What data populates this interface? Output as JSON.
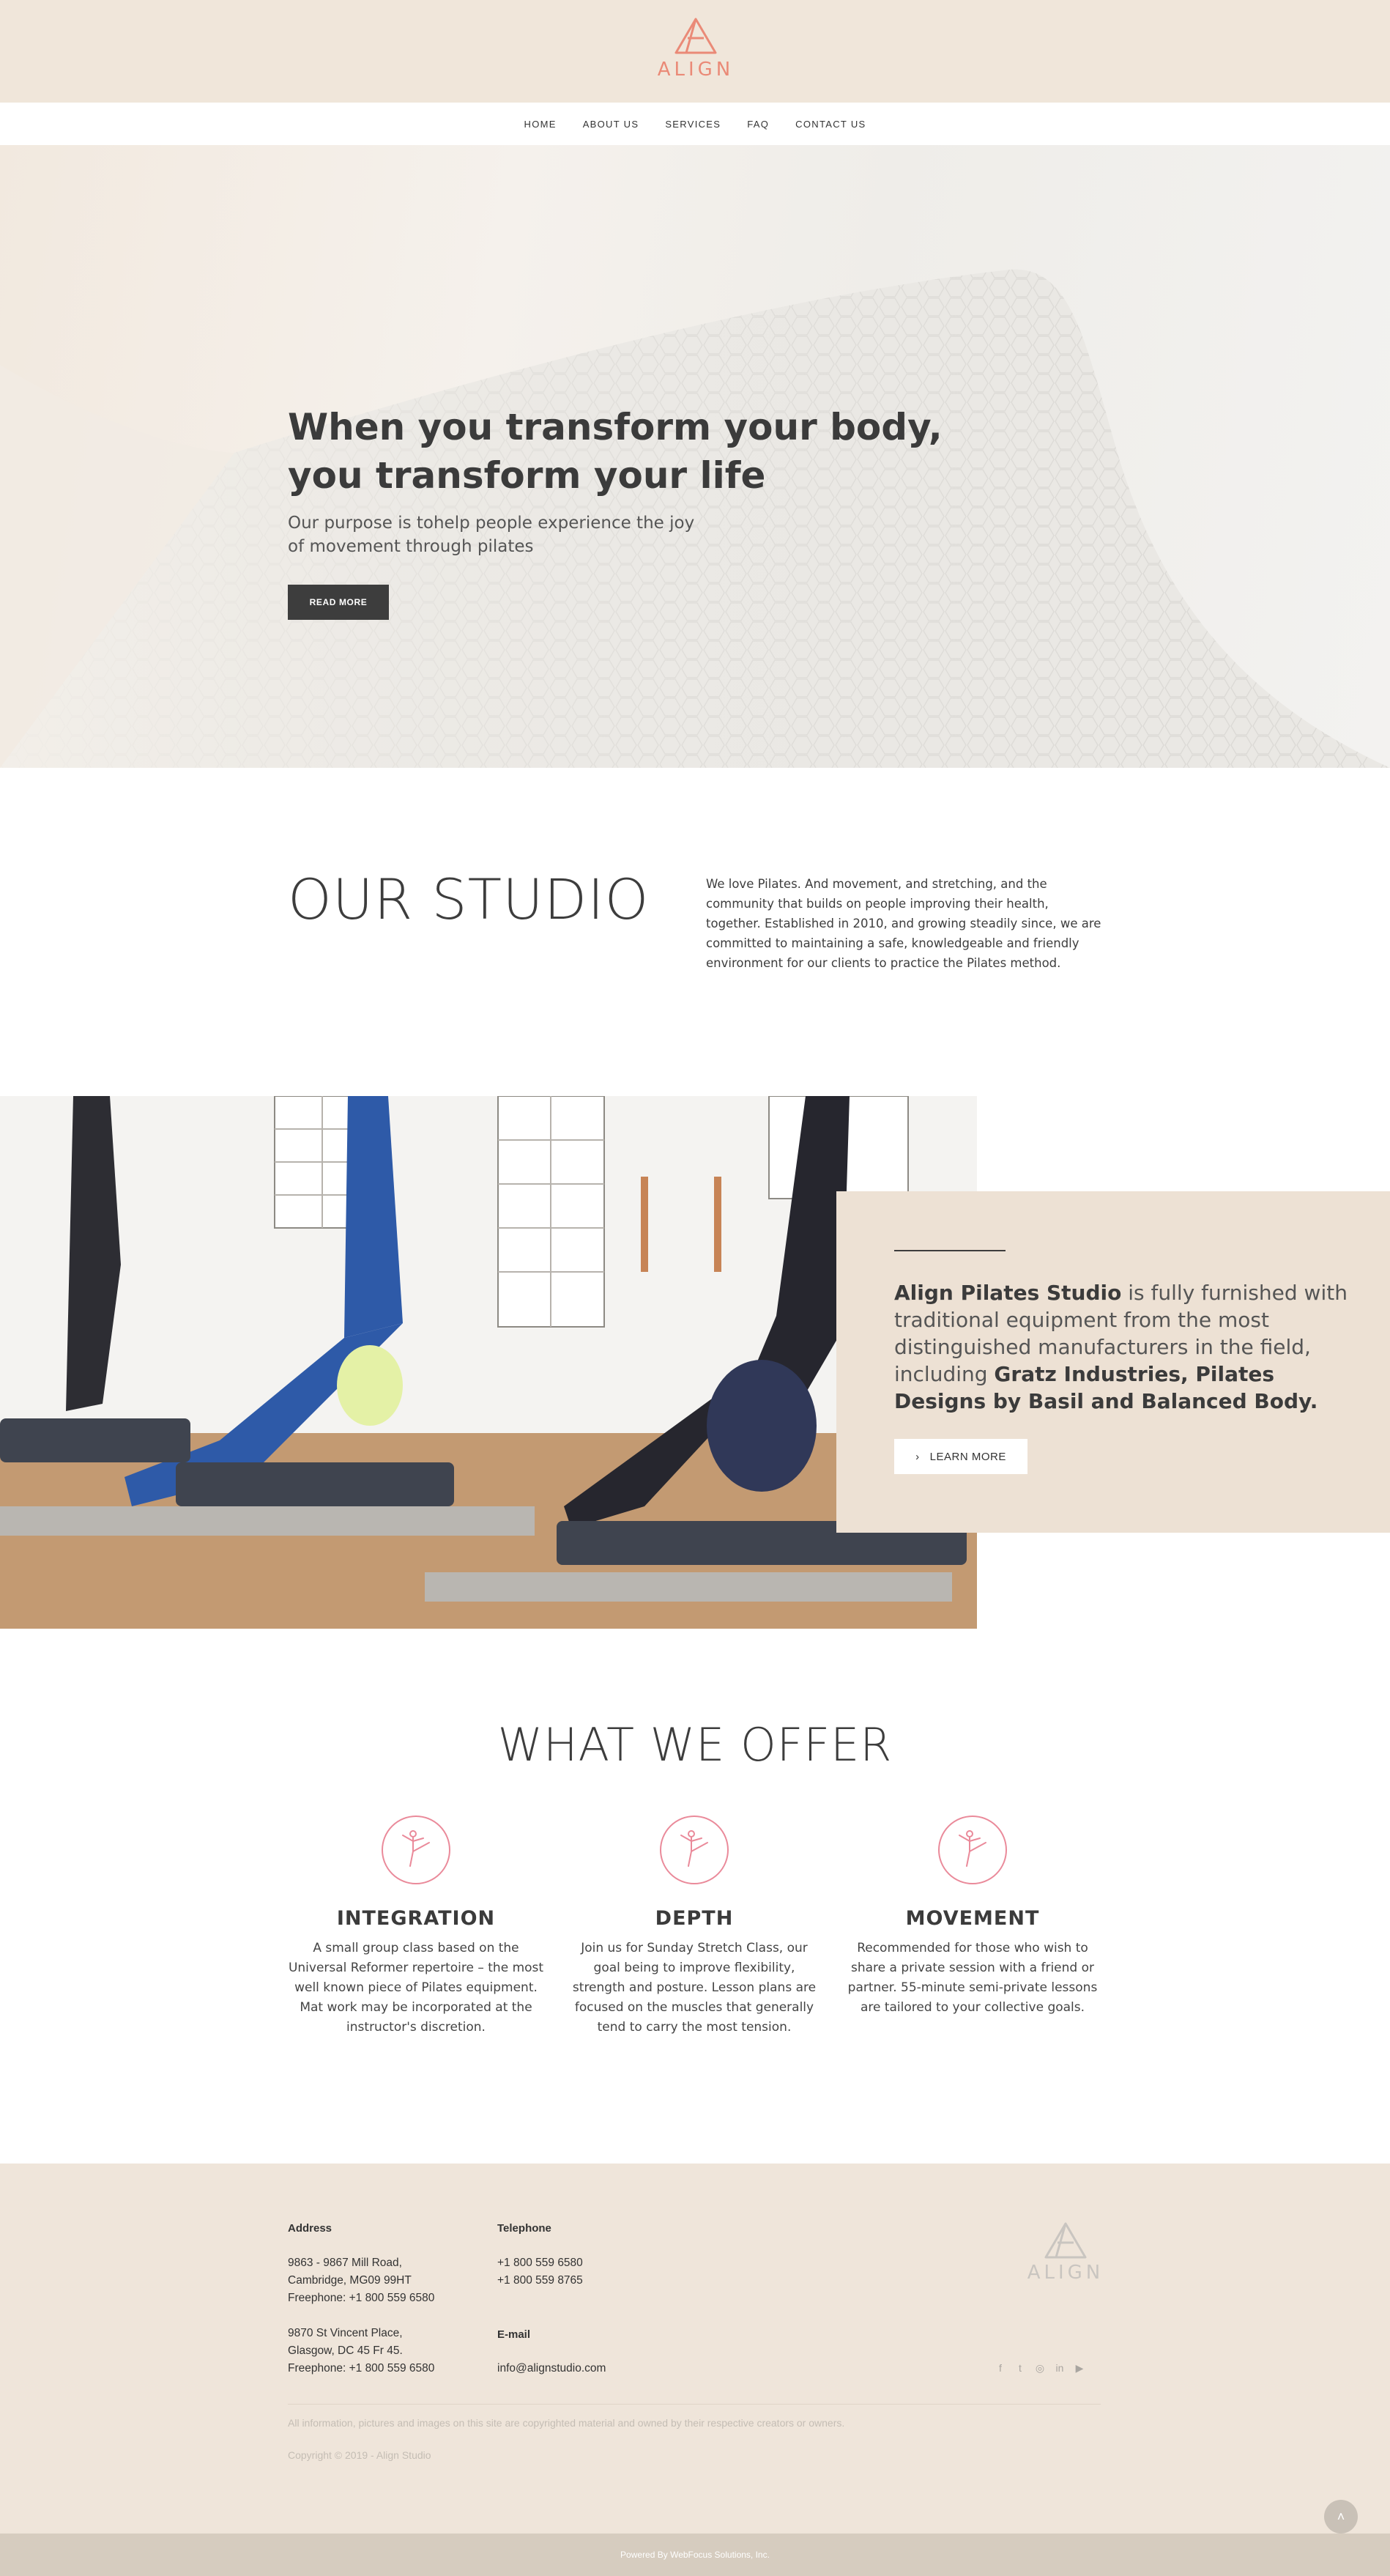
{
  "brand": {
    "name": "ALIGN",
    "accent_color": "#ea8a77"
  },
  "nav": {
    "items": [
      "HOME",
      "ABOUT US",
      "SERVICES",
      "FAQ",
      "CONTACT US"
    ]
  },
  "hero": {
    "title": "When you transform your body, you transform your life",
    "subtitle": "Our purpose is tohelp people experience the joy of movement through pilates",
    "button": "READ MORE"
  },
  "studio": {
    "title": "OUR STUDIO",
    "text": "We love Pilates. And movement, and stretching, and the community that builds on people improving their health, together. Established in 2010, and growing steadily since, we are committed to maintaining a safe, knowledgeable and friendly environment for our clients to practice the Pilates method."
  },
  "feature": {
    "name": "Align Pilates Studio",
    "text": " is fully furnished with traditional equipment from the most distinguished manufacturers in the field, including ",
    "brands": "Gratz Industries, Pilates Designs by Basil and Balanced Body.",
    "button": "LEARN MORE"
  },
  "offer": {
    "title": "WHAT WE OFFER",
    "icon": "yoga-pose-icon",
    "items": [
      {
        "title": "INTEGRATION",
        "text": "A small group class based on the Universal Reformer repertoire – the most well known piece of Pilates equipment. Mat work may be incorporated at the instructor's discretion."
      },
      {
        "title": "DEPTH",
        "text": "Join us for Sunday Stretch Class, our goal being to improve flexibility, strength and posture. Lesson plans are focused on the muscles that generally tend to carry the most tension."
      },
      {
        "title": "MOVEMENT",
        "text": "Recommended for those who wish to share a private session with a friend or partner. 55-minute semi-private lessons are tailored to your collective goals."
      }
    ]
  },
  "footer": {
    "address_label": "Address",
    "address1": [
      "9863 - 9867 Mill Road,",
      "Cambridge, MG09 99HT",
      "Freephone: +1 800 559 6580"
    ],
    "address2": [
      "9870 St Vincent Place,",
      "Glasgow, DC 45 Fr 45.",
      "Freephone: +1 800 559 6580"
    ],
    "telephone_label": "Telephone",
    "phones": [
      "+1 800 559 6580",
      "+1 800 559 8765"
    ],
    "email_label": "E-mail",
    "email": "info@alignstudio.com",
    "logo_text": "ALIGN",
    "social": [
      "facebook-icon",
      "twitter-icon",
      "instagram-icon",
      "linkedin-icon",
      "youtube-icon"
    ],
    "disclaimer": "All information, pictures and images on this site are copyrighted material and owned by their respective creators or owners.",
    "copyright": "Copyright © 2019 - Align Studio",
    "powered": "Powered By WebFocus Solutions, Inc."
  }
}
